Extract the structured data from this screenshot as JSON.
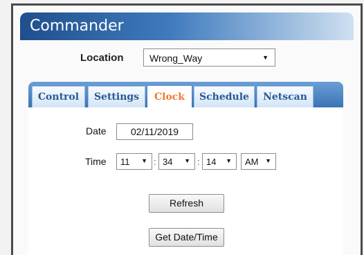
{
  "app": {
    "title": "Commander"
  },
  "location": {
    "label": "Location",
    "selected": "Wrong_Way"
  },
  "tabs": [
    {
      "label": "Control",
      "active": false
    },
    {
      "label": "Settings",
      "active": false
    },
    {
      "label": "Clock",
      "active": true
    },
    {
      "label": "Schedule",
      "active": false
    },
    {
      "label": "Netscan",
      "active": false
    }
  ],
  "clock": {
    "date_label": "Date",
    "date_value": "02/11/2019",
    "time_label": "Time",
    "hour": "11",
    "minute": "34",
    "second": "14",
    "ampm": "AM",
    "separator": ":",
    "refresh_label": "Refresh",
    "get_datetime_label": "Get Date/Time"
  },
  "icons": {
    "dropdown": "dropdown-arrow-icon"
  },
  "colors": {
    "header_start": "#1f4f8c",
    "tab_active_text": "#ef7a2f",
    "tab_text": "#2b5891"
  }
}
